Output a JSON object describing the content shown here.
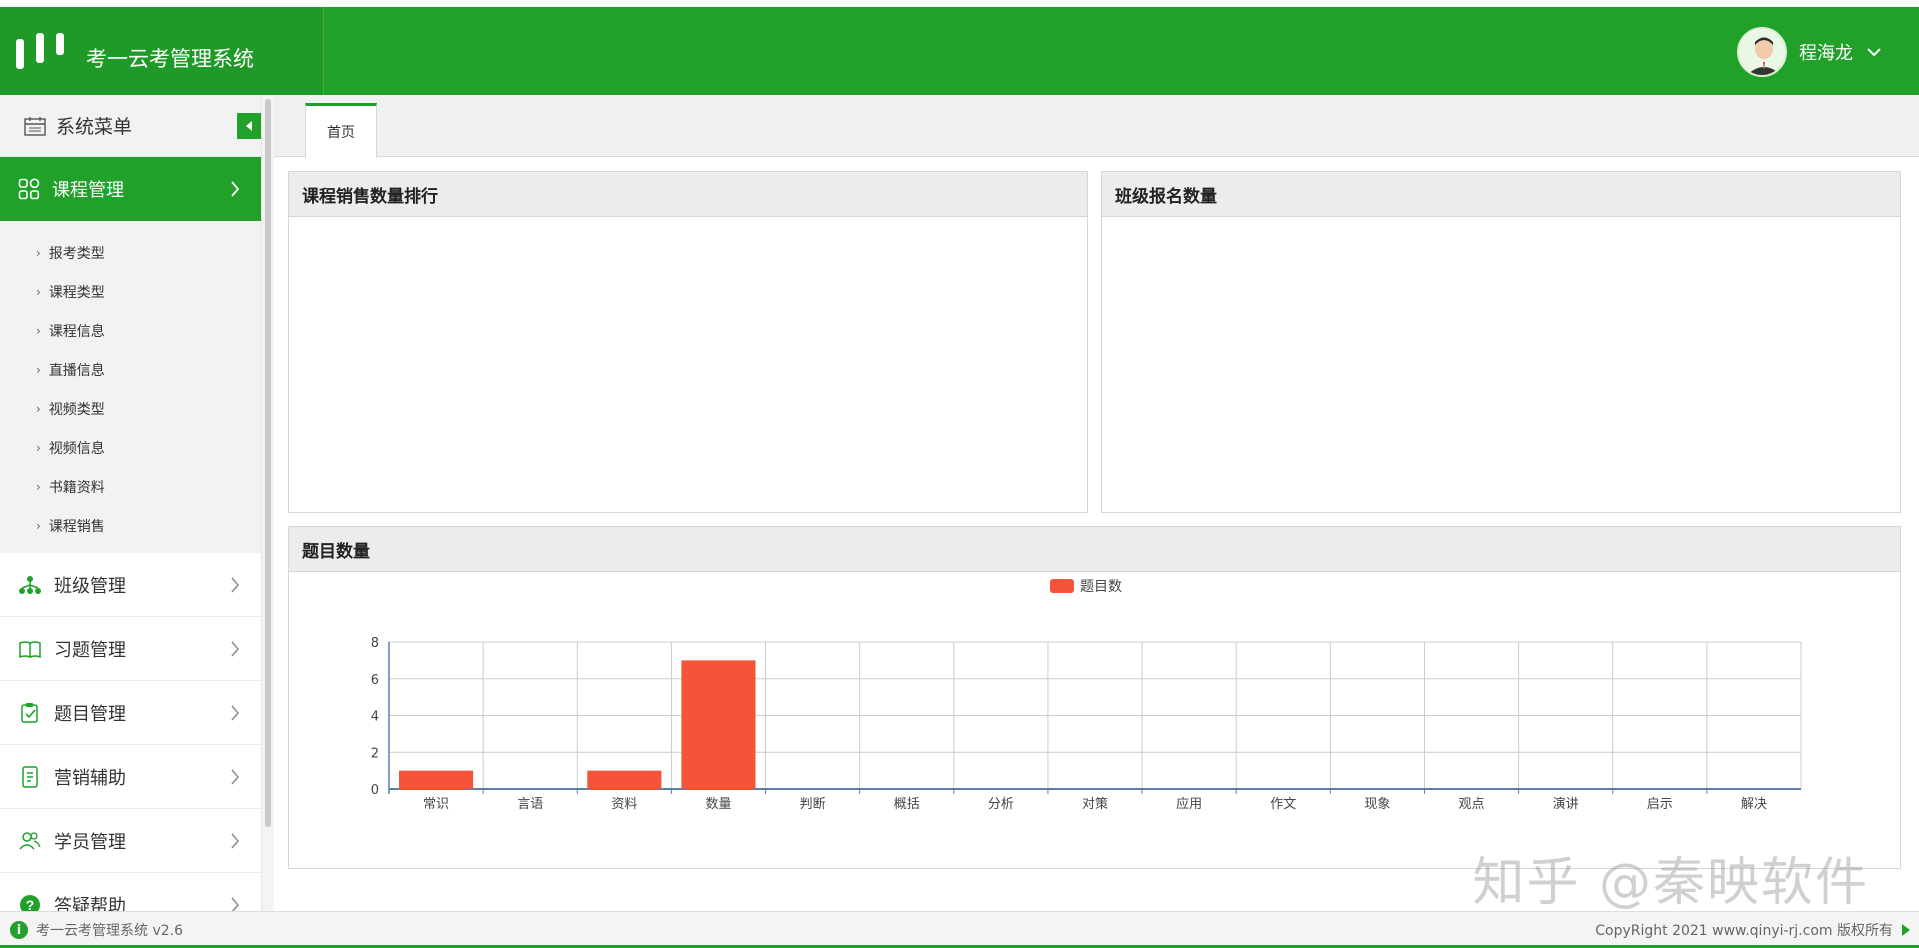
{
  "app": {
    "title": "考一云考管理系统",
    "user_name": "程海龙"
  },
  "colors": {
    "brand": "#21a02a",
    "bar": "#f4553a"
  },
  "sidebar": {
    "title": "系统菜单",
    "active_item": {
      "label": "课程管理",
      "icon": "grid-icon"
    },
    "sub_items": [
      {
        "label": "报考类型"
      },
      {
        "label": "课程类型"
      },
      {
        "label": "课程信息"
      },
      {
        "label": "直播信息"
      },
      {
        "label": "视频类型"
      },
      {
        "label": "视频信息"
      },
      {
        "label": "书籍资料"
      },
      {
        "label": "课程销售"
      }
    ],
    "items": [
      {
        "label": "班级管理",
        "icon": "org-chart-icon"
      },
      {
        "label": "习题管理",
        "icon": "book-icon"
      },
      {
        "label": "题目管理",
        "icon": "clipboard-check-icon"
      },
      {
        "label": "营销辅助",
        "icon": "phone-doc-icon"
      },
      {
        "label": "学员管理",
        "icon": "users-icon"
      },
      {
        "label": "答疑帮助",
        "icon": "question-icon"
      }
    ]
  },
  "tabs": [
    {
      "label": "首页"
    }
  ],
  "panels": {
    "sales_rank": {
      "title": "课程销售数量排行"
    },
    "class_signup": {
      "title": "班级报名数量"
    },
    "question_count": {
      "title": "题目数量"
    }
  },
  "chart_data": {
    "type": "bar",
    "title": "",
    "legend": "top-center",
    "categories": [
      "常识",
      "言语",
      "资料",
      "数量",
      "判断",
      "概括",
      "分析",
      "对策",
      "应用",
      "作文",
      "现象",
      "观点",
      "演讲",
      "启示",
      "解决"
    ],
    "series": [
      {
        "name": "题目数",
        "values": [
          1,
          0,
          1,
          7,
          0,
          0,
          0,
          0,
          0,
          0,
          0,
          0,
          0,
          0,
          0
        ]
      }
    ],
    "ylim": [
      0,
      8
    ],
    "yticks": [
      0,
      2,
      4,
      6,
      8
    ],
    "grid": true,
    "xlabel": "",
    "ylabel": ""
  },
  "footer": {
    "left": "考一云考管理系统 v2.6",
    "right": "CopyRight 2021  www.qinyi-rj.com 版权所有"
  },
  "watermark": "知乎 @秦映软件"
}
